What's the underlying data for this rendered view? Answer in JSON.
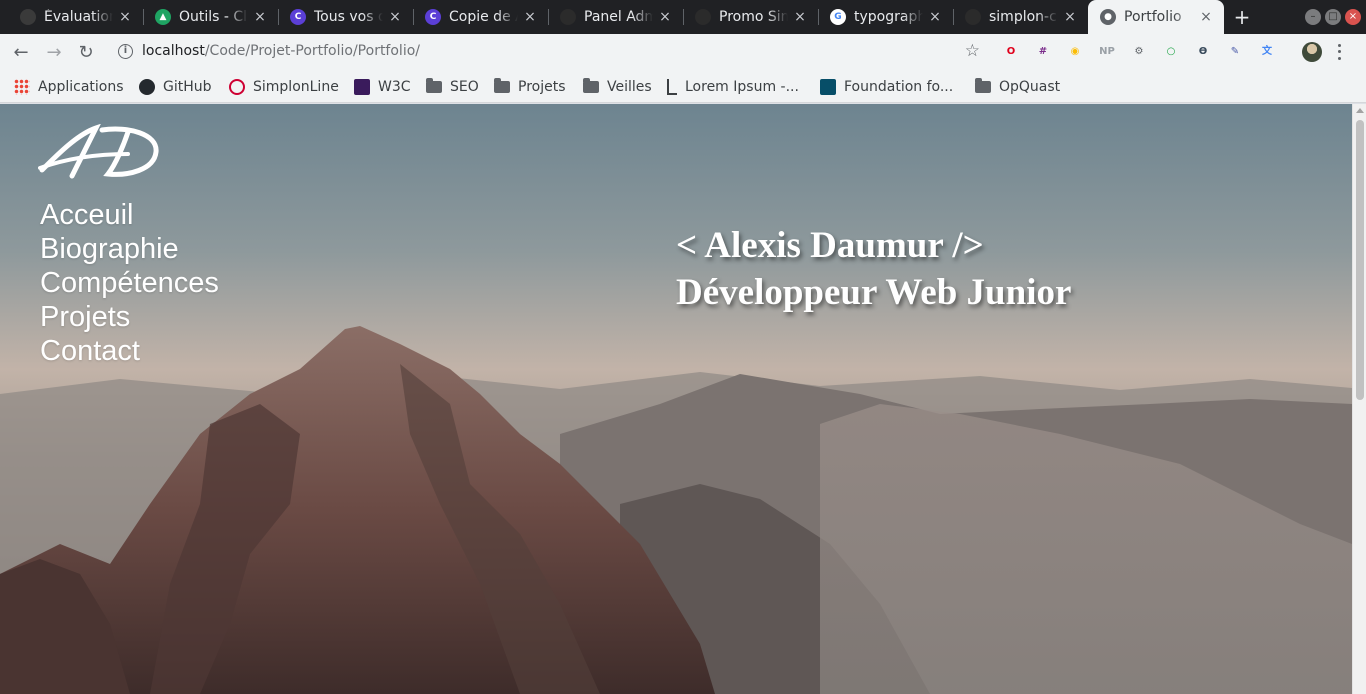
{
  "browser": {
    "tabs": [
      {
        "title": "Évaluation",
        "favicon": "dark-circle-icon",
        "color": "#3a3a3a",
        "glyph": ""
      },
      {
        "title": "Outils - Cle",
        "favicon": "google-drive-icon",
        "color": "#1fa463",
        "glyph": "▲"
      },
      {
        "title": "Tous vos d",
        "favicon": "canva-icon",
        "color": "#5b3fd6",
        "glyph": "C"
      },
      {
        "title": "Copie de A",
        "favicon": "canva-icon",
        "color": "#5b3fd6",
        "glyph": "C"
      },
      {
        "title": "Panel Adm",
        "favicon": "github-icon",
        "color": "#2b2b2b",
        "glyph": ""
      },
      {
        "title": "Promo Sim",
        "favicon": "github-icon",
        "color": "#2b2b2b",
        "glyph": ""
      },
      {
        "title": "typograph",
        "favicon": "google-icon",
        "color": "#ffffff",
        "glyph": "G"
      },
      {
        "title": "simplon-cl",
        "favicon": "github-icon",
        "color": "#2b2b2b",
        "glyph": ""
      },
      {
        "title": "Portfolio",
        "favicon": "globe-icon",
        "color": "#5f6368",
        "glyph": "●"
      }
    ],
    "active_tab_index": 8,
    "new_tab_label": "+",
    "url_host": "localhost",
    "url_path": "/Code/Projet-Portfolio/Portfolio/",
    "bookmarks": [
      {
        "label": "Applications",
        "icon": "apps-grid-icon"
      },
      {
        "label": "GitHub",
        "icon": "github-icon"
      },
      {
        "label": "SimplonLine",
        "icon": "simplon-icon"
      },
      {
        "label": "W3C",
        "icon": "w3c-icon"
      },
      {
        "label": "SEO",
        "icon": "folder-icon"
      },
      {
        "label": "Projets",
        "icon": "folder-icon"
      },
      {
        "label": "Veilles",
        "icon": "folder-icon"
      },
      {
        "label": "Lorem Ipsum -...",
        "icon": "lorem-icon"
      },
      {
        "label": "Foundation fo...",
        "icon": "foundation-icon"
      },
      {
        "label": "OpQuast",
        "icon": "folder-icon"
      }
    ],
    "extensions": [
      {
        "name": "opera-adblock-icon",
        "color": "#e0001b",
        "glyph": "O"
      },
      {
        "name": "grid-tool-icon",
        "color": "#7b2d8b",
        "glyph": "#"
      },
      {
        "name": "chrome-color-icon",
        "color": "#fbbc05",
        "glyph": "◉"
      },
      {
        "name": "np-icon",
        "color": "#9aa0a6",
        "glyph": "NP"
      },
      {
        "name": "settings-ext-icon",
        "color": "#5f6368",
        "glyph": "⚙"
      },
      {
        "name": "green-circle-icon",
        "color": "#1ea446",
        "glyph": "○"
      },
      {
        "name": "ublock-icon",
        "color": "#3a4b5c",
        "glyph": "Ѳ"
      },
      {
        "name": "eyedropper-icon",
        "color": "#4a5aa8",
        "glyph": "✎"
      },
      {
        "name": "translate-icon",
        "color": "#4285f4",
        "glyph": "文"
      }
    ]
  },
  "page": {
    "logo_text": "AD",
    "nav": [
      "Acceuil",
      "Biographie",
      "Compétences",
      "Projets",
      "Contact"
    ],
    "hero_line1": "< Alexis Daumur />",
    "hero_line2": "Développeur Web Junior"
  }
}
